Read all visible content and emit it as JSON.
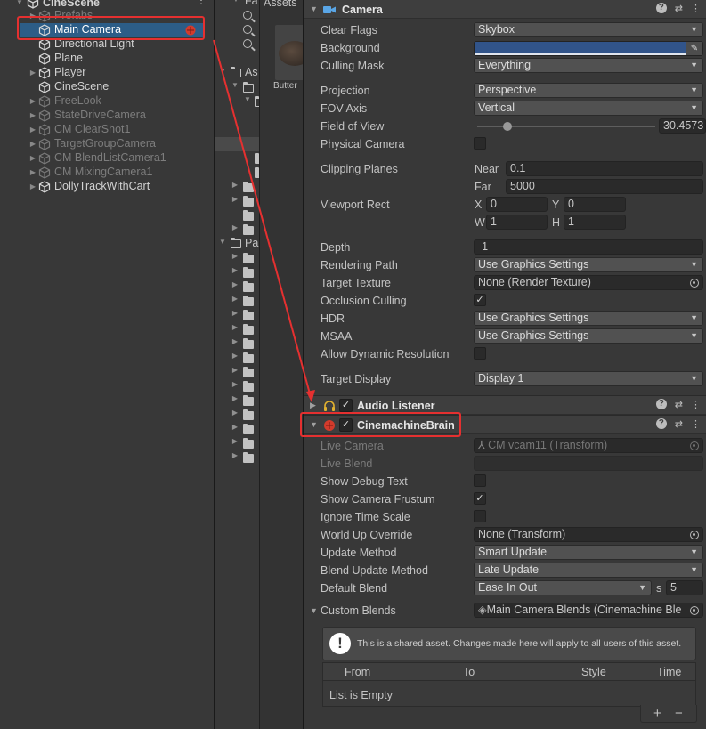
{
  "hierarchy": {
    "scene_name": "CineScene",
    "items": [
      {
        "label": "Prefabs",
        "state": "disabled",
        "expandable": true
      },
      {
        "label": "Main Camera",
        "state": "selected",
        "expandable": false
      },
      {
        "label": "Directional Light",
        "state": "normal",
        "expandable": false
      },
      {
        "label": "Plane",
        "state": "normal",
        "expandable": false
      },
      {
        "label": "Player",
        "state": "normal",
        "expandable": true
      },
      {
        "label": "CineScene",
        "state": "normal",
        "expandable": false
      },
      {
        "label": "FreeLook",
        "state": "disabled",
        "expandable": true
      },
      {
        "label": "StateDriveCamera",
        "state": "disabled",
        "expandable": true
      },
      {
        "label": "CM ClearShot1",
        "state": "disabled",
        "expandable": true
      },
      {
        "label": "TargetGroupCamera",
        "state": "disabled",
        "expandable": true
      },
      {
        "label": "CM BlendListCamera1",
        "state": "disabled",
        "expandable": true
      },
      {
        "label": "CM MixingCamera1",
        "state": "disabled",
        "expandable": true
      },
      {
        "label": "DollyTrackWithCart",
        "state": "normal",
        "expandable": true
      }
    ]
  },
  "project": {
    "favorites_label": "Fa",
    "assets_label": "As",
    "packages_label": "Pa",
    "breadcrumb": "Assets",
    "asset_item_label": "Butter"
  },
  "inspector": {
    "camera": {
      "title": "Camera",
      "clear_flags_label": "Clear Flags",
      "clear_flags_value": "Skybox",
      "background_label": "Background",
      "background_color": "#31548a",
      "culling_mask_label": "Culling Mask",
      "culling_mask_value": "Everything",
      "projection_label": "Projection",
      "projection_value": "Perspective",
      "fov_axis_label": "FOV Axis",
      "fov_axis_value": "Vertical",
      "fov_label": "Field of View",
      "fov_value": "30.4573",
      "physical_camera_label": "Physical Camera",
      "clipping_label": "Clipping Planes",
      "near_label": "Near",
      "near_value": "0.1",
      "far_label": "Far",
      "far_value": "5000",
      "viewport_label": "Viewport Rect",
      "vx_label": "X",
      "vx_value": "0",
      "vy_label": "Y",
      "vy_value": "0",
      "vw_label": "W",
      "vw_value": "1",
      "vh_label": "H",
      "vh_value": "1",
      "depth_label": "Depth",
      "depth_value": "-1",
      "rendering_path_label": "Rendering Path",
      "rendering_path_value": "Use Graphics Settings",
      "target_texture_label": "Target Texture",
      "target_texture_value": "None (Render Texture)",
      "occlusion_label": "Occlusion Culling",
      "hdr_label": "HDR",
      "hdr_value": "Use Graphics Settings",
      "msaa_label": "MSAA",
      "msaa_value": "Use Graphics Settings",
      "dynres_label": "Allow Dynamic Resolution",
      "target_display_label": "Target Display",
      "target_display_value": "Display 1"
    },
    "audio_listener": {
      "title": "Audio Listener"
    },
    "brain": {
      "title": "CinemachineBrain",
      "live_camera_label": "Live Camera",
      "live_camera_value": "CM vcam11 (Transform)",
      "live_blend_label": "Live Blend",
      "show_debug_label": "Show Debug Text",
      "show_frustum_label": "Show Camera Frustum",
      "ignore_timescale_label": "Ignore Time Scale",
      "world_up_label": "World Up Override",
      "world_up_value": "None (Transform)",
      "update_method_label": "Update Method",
      "update_method_value": "Smart Update",
      "blend_update_label": "Blend Update Method",
      "blend_update_value": "Late Update",
      "default_blend_label": "Default Blend",
      "default_blend_value": "Ease In Out",
      "default_blend_s_label": "s",
      "default_blend_time": "5",
      "custom_blends_label": "Custom Blends",
      "custom_blends_value": "Main Camera Blends (Cinemachine Ble",
      "shared_asset_note": "This is a shared asset.  Changes made here will apply to all users of this asset.",
      "table_headers": [
        "From",
        "To",
        "Style",
        "Time"
      ],
      "empty_text": "List is Empty",
      "add_label": "+",
      "remove_label": "−"
    }
  },
  "colors": {
    "selection": "#2c5d87",
    "highlight_box": "#e53030"
  }
}
